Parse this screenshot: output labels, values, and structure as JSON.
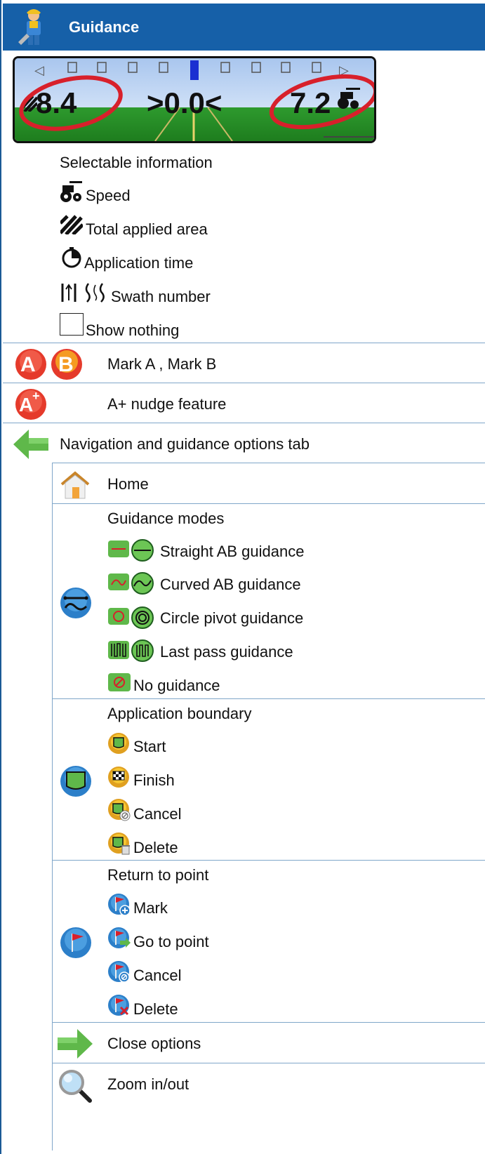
{
  "header": {
    "title": "Guidance"
  },
  "dashboard": {
    "left_value": "8.4",
    "center_value": ">0.0<",
    "right_value": "7.2",
    "arrow_left": "◁",
    "arrow_right": "▷"
  },
  "selectable": {
    "heading": "Selectable information",
    "speed": "Speed",
    "area": "Total applied area",
    "time": "Application time",
    "swath": "Swath number",
    "nothing": "Show nothing"
  },
  "marks": {
    "a_letter": "A",
    "b_letter": "B",
    "mark_label": "Mark A , Mark B",
    "aplus_letter": "A",
    "aplus_sup": "+",
    "aplus_label": "A+ nudge feature"
  },
  "nav_tab": {
    "label": "Navigation and guidance options tab"
  },
  "home": {
    "label": "Home"
  },
  "guidance_modes": {
    "heading": "Guidance modes",
    "straight": "Straight AB guidance",
    "curved": "Curved AB guidance",
    "circle": "Circle pivot guidance",
    "last": "Last pass guidance",
    "none": "No guidance"
  },
  "boundary": {
    "heading": "Application boundary",
    "start": "Start",
    "finish": "Finish",
    "cancel": "Cancel",
    "delete": "Delete"
  },
  "return_point": {
    "heading": "Return to point",
    "mark": "Mark",
    "go": "Go to point",
    "cancel": "Cancel",
    "delete": "Delete"
  },
  "close": {
    "label": "Close options"
  },
  "zoom": {
    "label": "Zoom in/out"
  },
  "colors": {
    "header_bg": "#1660a8",
    "mark_red": "#e53a2b",
    "mark_orange": "#f59b22",
    "green_arrow": "#5fb84a",
    "blue_circle": "#2c7fc9",
    "ellipse_red": "#d8202b"
  }
}
